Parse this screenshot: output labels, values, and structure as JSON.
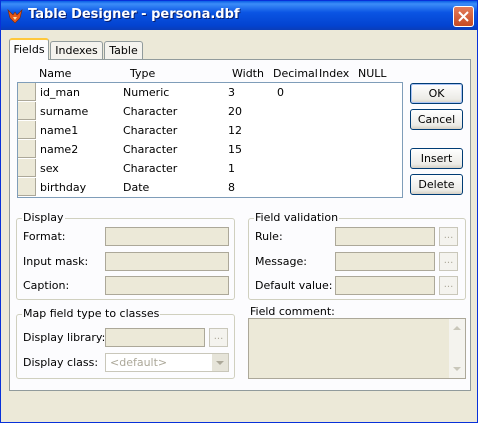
{
  "window": {
    "title": "Table Designer - persona.dbf"
  },
  "tabs": [
    {
      "label": "Fields",
      "active": true
    },
    {
      "label": "Indexes",
      "active": false
    },
    {
      "label": "Table",
      "active": false
    }
  ],
  "grid": {
    "headers": [
      "Name",
      "Type",
      "Width",
      "Decimal",
      "Index",
      "NULL"
    ],
    "rows": [
      {
        "name": "id_man",
        "type": "Numeric",
        "width": "3",
        "decimal": "0"
      },
      {
        "name": "surname",
        "type": "Character",
        "width": "20",
        "decimal": ""
      },
      {
        "name": "name1",
        "type": "Character",
        "width": "12",
        "decimal": ""
      },
      {
        "name": "name2",
        "type": "Character",
        "width": "15",
        "decimal": ""
      },
      {
        "name": "sex",
        "type": "Character",
        "width": "1",
        "decimal": ""
      },
      {
        "name": "birthday",
        "type": "Date",
        "width": "8",
        "decimal": ""
      }
    ]
  },
  "buttons": {
    "ok": "OK",
    "cancel": "Cancel",
    "insert": "Insert",
    "delete": "Delete"
  },
  "display": {
    "title": "Display",
    "format_label": "Format:",
    "input_mask_label": "Input mask:",
    "caption_label": "Caption:",
    "format_value": "",
    "input_mask_value": "",
    "caption_value": ""
  },
  "validation": {
    "title": "Field validation",
    "rule_label": "Rule:",
    "message_label": "Message:",
    "default_label": "Default value:",
    "ellipsis": "..."
  },
  "map": {
    "title": "Map field type to classes",
    "library_label": "Display library:",
    "class_label": "Display class:",
    "class_value": "<default>"
  },
  "comment": {
    "label": "Field comment:"
  },
  "icons": [
    "fox-app-icon",
    "close-icon",
    "scroll-up-icon",
    "scroll-down-icon",
    "dropdown-arrow-icon"
  ],
  "colors": {
    "titlebar": "#0A54E3",
    "face": "#ECE9D8",
    "panel": "#FCFCFE",
    "close": "#C64A23"
  }
}
